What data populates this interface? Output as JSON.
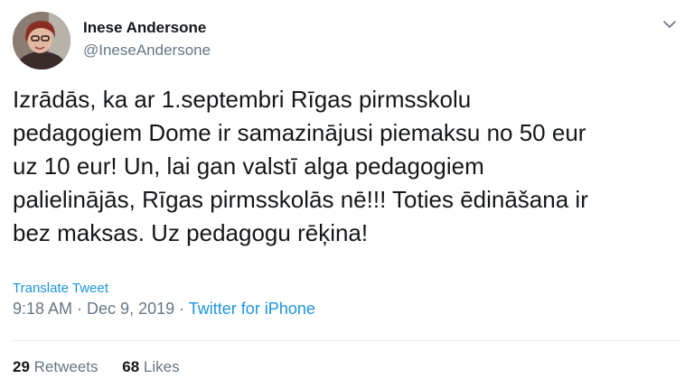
{
  "author": {
    "name": "Inese Andersone",
    "handle": "@IneseAndersone"
  },
  "tweet": {
    "lines": [
      "Izrādās, ka ar 1.septembri Rīgas pirmsskolu",
      "pedagogiem Dome ir samazinājusi piemaksu no 50 eur",
      "uz 10 eur! Un, lai gan valstī alga pedagogiem",
      "palielinājās, Rīgas pirmsskolās nē!!! Toties ēdināšana ir",
      "bez maksas. Uz pedagogu rēķina!"
    ],
    "translate_label": "Translate Tweet",
    "time": "9:18 AM",
    "separator": " · ",
    "date": "Dec 9, 2019",
    "source": "Twitter for iPhone"
  },
  "stats": {
    "retweets_count": "29",
    "retweets_label": "Retweets",
    "likes_count": "68",
    "likes_label": "Likes"
  },
  "icons": {
    "menu": "chevron-down-icon"
  },
  "colors": {
    "link": "#1b95e0",
    "secondary_text": "#657786",
    "primary_text": "#14171a"
  }
}
